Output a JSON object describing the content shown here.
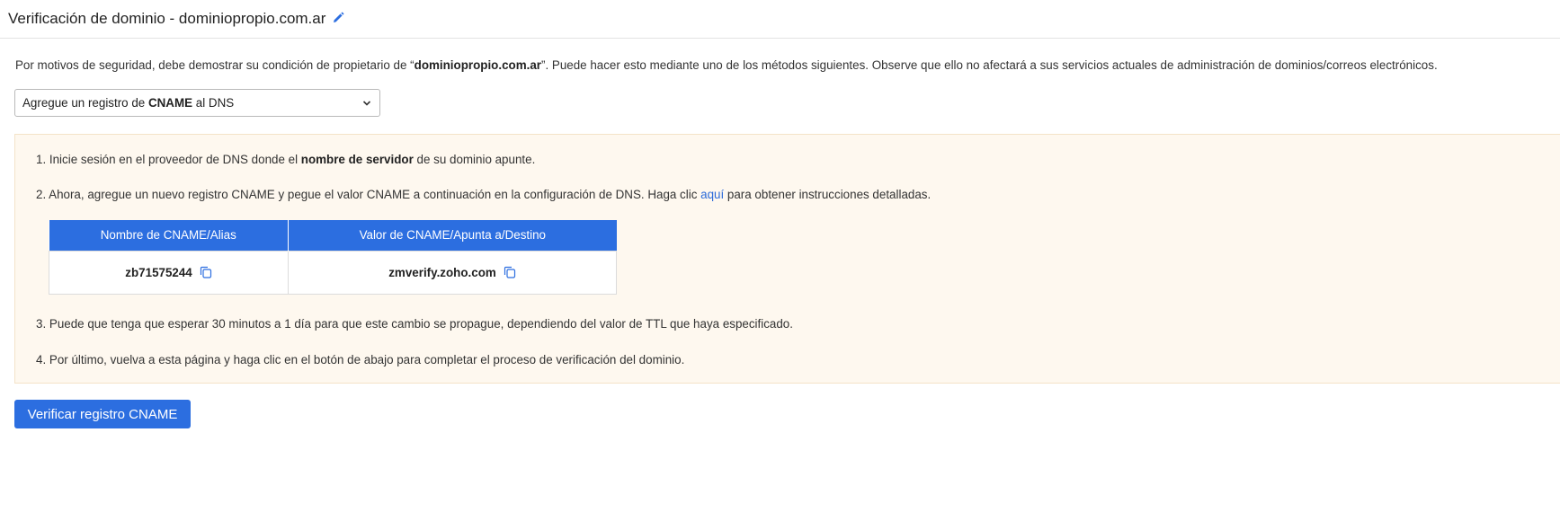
{
  "header": {
    "title": "Verificación de dominio - dominiopropio.com.ar",
    "edit_icon": "pencil-icon"
  },
  "intro": {
    "text_before": "Por motivos de seguridad, debe demostrar su condición de propietario de “",
    "domain": "dominiopropio.com.ar",
    "text_after": "”. Puede hacer esto mediante uno de los métodos siguientes. Observe que ello no afectará a sus servicios actuales de administración de dominios/correos electrónicos."
  },
  "method_select": {
    "before": "Agregue un registro de ",
    "bold": "CNAME",
    "after": " al DNS"
  },
  "steps": {
    "step1": {
      "before": "1. Inicie sesión en el proveedor de DNS donde el ",
      "bold": "nombre de servidor",
      "after": " de su dominio apunte."
    },
    "step2": {
      "before": "2. Ahora, agregue un nuevo registro CNAME y pegue el valor CNAME a continuación en la configuración de DNS. Haga clic ",
      "link": "aquí",
      "after": " para obtener instrucciones detalladas."
    },
    "step3": "3. Puede que tenga que esperar 30 minutos a 1 día para que este cambio se propague, dependiendo del valor de TTL que haya especificado.",
    "step4": "4. Por último, vuelva a esta página y haga clic en el botón de abajo para completar el proceso de verificación del dominio."
  },
  "table": {
    "headers": [
      "Nombre de CNAME/Alias",
      "Valor de CNAME/Apunta a/Destino"
    ],
    "row": [
      "zb71575244",
      "zmverify.zoho.com"
    ]
  },
  "verify_button": "Verificar registro CNAME",
  "colors": {
    "accent": "#2c6ee0",
    "link": "#2b6ad9",
    "instructions_bg": "#fef8ef"
  }
}
